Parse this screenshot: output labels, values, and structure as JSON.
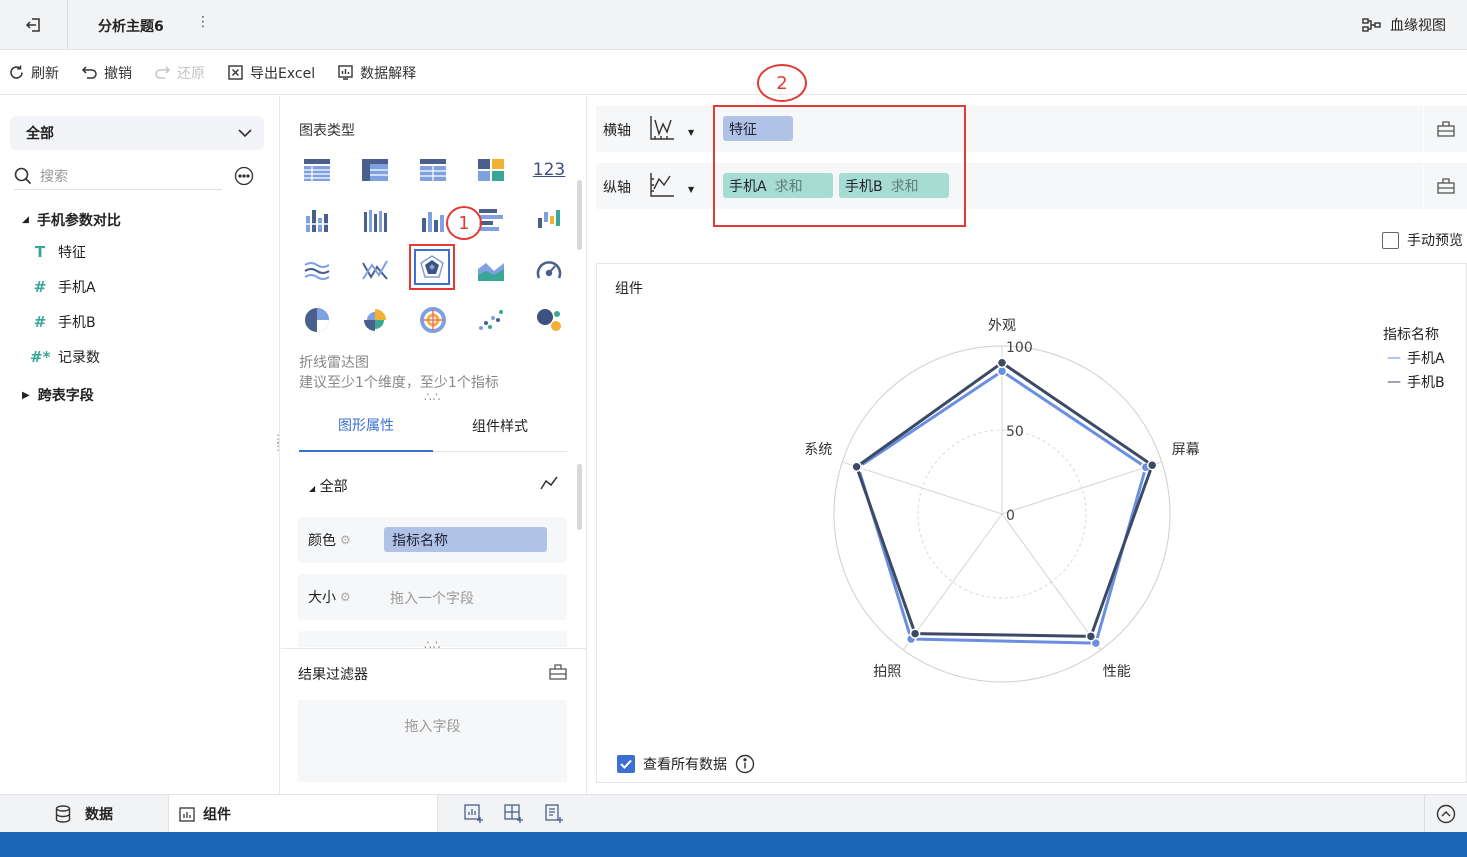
{
  "header": {
    "title": "分析主题6",
    "more": "⋮",
    "lineage_label": "血缘视图"
  },
  "toolbar": {
    "refresh": "刷新",
    "undo": "撤销",
    "redo": "还原",
    "export": "导出Excel",
    "explain": "数据解释"
  },
  "left": {
    "scope": "全部",
    "search_placeholder": "搜索",
    "table_name": "手机参数对比",
    "fields": [
      {
        "type": "T",
        "name": "特征"
      },
      {
        "type": "#",
        "name": "手机A"
      },
      {
        "type": "#",
        "name": "手机B"
      },
      {
        "type": "#*",
        "name": "记录数"
      }
    ],
    "cross_table": "跨表字段"
  },
  "middle": {
    "chart_type_label": "图表类型",
    "selected_chart_name": "折线雷达图",
    "selected_chart_hint": "建议至少1个维度，至少1个指标",
    "tabs": [
      "图形属性",
      "组件样式"
    ],
    "prop_scope": "全部",
    "color_label": "颜色",
    "color_field": "指标名称",
    "size_label": "大小",
    "size_placeholder": "拖入一个字段",
    "filter_title": "结果过滤器",
    "filter_placeholder": "拖入字段"
  },
  "axes": {
    "x_label": "横轴",
    "x_fields": [
      "特征"
    ],
    "y_label": "纵轴",
    "y_fields": [
      {
        "name": "手机A",
        "agg": "求和"
      },
      {
        "name": "手机B",
        "agg": "求和"
      }
    ]
  },
  "annotations": {
    "mark1": "1",
    "mark2": "2"
  },
  "manual_preview": "手动预览",
  "component": {
    "title": "组件",
    "view_all": "查看所有数据"
  },
  "bottom": {
    "data_tab": "数据",
    "component_tab": "组件"
  },
  "colors": {
    "accent": "#3b6fd4",
    "series_a": "#6b8fe0",
    "series_b": "#3d4a66",
    "annotation": "#e53935",
    "field_dim": "#b0c3e6",
    "field_measure": "#a7dcd3"
  },
  "chart_data": {
    "type": "radar",
    "legend_title": "指标名称",
    "categories": [
      "外观",
      "屏幕",
      "性能",
      "拍照",
      "系统"
    ],
    "rmax": 100,
    "ticks": [
      0,
      50,
      100
    ],
    "series": [
      {
        "name": "手机A",
        "values": [
          85,
          90,
          95,
          92,
          90
        ]
      },
      {
        "name": "手机B",
        "values": [
          90,
          94,
          90,
          88,
          91
        ]
      }
    ]
  }
}
